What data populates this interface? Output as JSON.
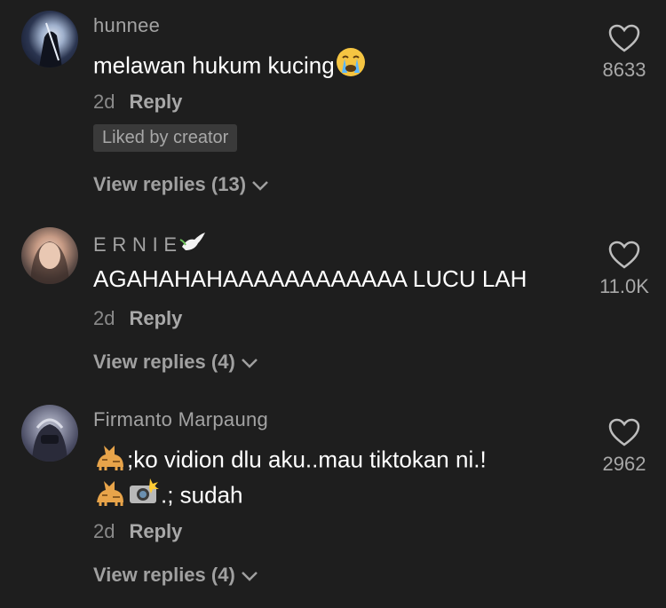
{
  "comments": [
    {
      "username": "hunnee",
      "text": "melawan hukum kucing",
      "time": "2d",
      "reply_label": "Reply",
      "badge": "Liked by creator",
      "view_replies": "View replies (13)",
      "likes": "8633"
    },
    {
      "username": "E R N I E",
      "text": "AGAHAHAHAAAAAAAAAAAA LUCU LAH",
      "time": "2d",
      "reply_label": "Reply",
      "view_replies": "View replies (4)",
      "likes": "11.0K"
    },
    {
      "username": "Firmanto Marpaung",
      "text_line1": ";ko vidion dlu aku..mau tiktokan ni.!",
      "text_line2": ".; sudah",
      "time": "2d",
      "reply_label": "Reply",
      "view_replies": "View replies (4)",
      "likes": "2962"
    }
  ],
  "icons": [
    "heart-icon",
    "chevron-down-icon",
    "crying-face-icon",
    "dove-icon",
    "cat-icon",
    "camera-flash-icon"
  ],
  "colors": {
    "background": "#1e1e1e",
    "text": "#ffffff",
    "muted": "#a3a3a3"
  }
}
